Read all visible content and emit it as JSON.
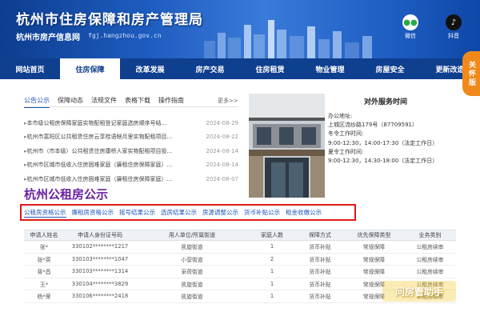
{
  "header": {
    "title": "杭州市住房保障和房产管理局",
    "subtitle": "杭州市房产信息网",
    "url": "fgj.hangzhou.gov.cn",
    "social": [
      {
        "label": "微信",
        "icon": "wechat-icon"
      },
      {
        "label": "抖音",
        "icon": "douyin-icon"
      }
    ]
  },
  "nav": {
    "items": [
      "网站首页",
      "住房保障",
      "改革发展",
      "房产交易",
      "住房租赁",
      "物业管理",
      "房屋安全",
      "更新改造"
    ],
    "active_index": 1
  },
  "care_button": "关怀版",
  "news": {
    "tabs": [
      "公告公示",
      "保障动态",
      "法规文件",
      "表格下载",
      "操作指南"
    ],
    "active_tab": 0,
    "more": "更多>>",
    "items": [
      {
        "title": "本市级公租房保障家庭实物配租登记家庭选房顺序号结...",
        "date": "2024-08-29"
      },
      {
        "title": "杭州市富阳区公共租赁住房云享桂语映月里实物配租项目...",
        "date": "2024-08-22"
      },
      {
        "title": "杭州市（市本级）公共租赁住房康桥人家实物配租项目投...",
        "date": "2024-08-14"
      },
      {
        "title": "杭州市区城市低收入住房困难家庭（廉租住房保障家庭）...",
        "date": "2024-08-14"
      },
      {
        "title": "杭州市区城市低收入住房困难家庭（廉租住房保障家庭）...",
        "date": "2024-08-07"
      }
    ]
  },
  "service": {
    "title": "对外服务时间",
    "lines": [
      "办公地址:",
      "上城区流纱路179号（87709591）",
      "冬令工作时间:",
      "9:00-12:30，14:00-17:30（法定工作日）",
      "夏令工作时间:",
      "9:00-12:30，14:30-18:00（法定工作日）"
    ]
  },
  "section_title": "杭州公租房公示",
  "categories": {
    "items": [
      "公租房资格公示",
      "廉租房资格公示",
      "摇号结果公示",
      "选房结果公示",
      "房源调整公示",
      "货币补贴公示",
      "租金收缴公示"
    ],
    "active_index": 0
  },
  "table": {
    "headers": [
      "申请人姓名",
      "申请人身份证号码",
      "用人单位/所属街道",
      "家庭人数",
      "保障方式",
      "优先保障类型",
      "业务类别"
    ],
    "rows": [
      [
        "张*",
        "330102********1217",
        "凯旋街道",
        "1",
        "货币补贴",
        "常规保障",
        "公租房续审"
      ],
      [
        "张*英",
        "330103********1047",
        "小营街道",
        "2",
        "货币补贴",
        "常规保障",
        "公租房续审"
      ],
      [
        "蒋*昌",
        "330103********1314",
        "采荷街道",
        "1",
        "货币补贴",
        "常规保障",
        "公租房续审"
      ],
      [
        "王*",
        "330104********3829",
        "凯旋街道",
        "1",
        "货币补贴",
        "常规保障",
        "公租房续审"
      ],
      [
        "杨*荣",
        "330106********2418",
        "凯旋街道",
        "1",
        "货币补贴",
        "常规保障",
        "公租房续审"
      ]
    ]
  },
  "watermark": "问房管助手"
}
